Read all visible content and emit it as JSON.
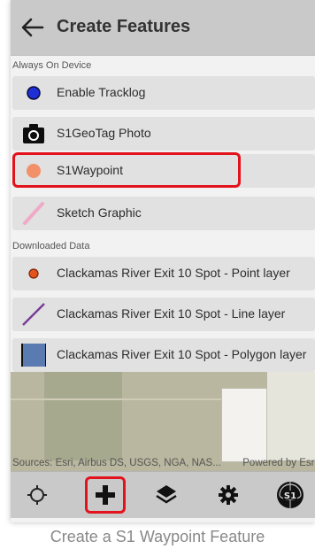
{
  "header": {
    "title": "Create Features"
  },
  "sections": {
    "device_label": "Always On Device",
    "downloaded_label": "Downloaded Data"
  },
  "device_items": [
    {
      "label": "Enable Tracklog",
      "icon": "blue-dot-icon"
    },
    {
      "label": "S1GeoTag Photo",
      "icon": "camera-icon"
    },
    {
      "label": "S1Waypoint",
      "icon": "orange-dot-icon"
    },
    {
      "label": "Sketch Graphic",
      "icon": "pink-line-icon"
    }
  ],
  "downloaded_items": [
    {
      "label": "Clackamas River Exit 10 Spot - Point layer",
      "icon": "point-layer-icon"
    },
    {
      "label": "Clackamas River Exit 10 Spot - Line layer",
      "icon": "line-layer-icon"
    },
    {
      "label": "Clackamas River Exit 10 Spot - Polygon layer",
      "icon": "polygon-layer-icon"
    }
  ],
  "map": {
    "attribution": "Sources: Esri, Airbus DS, USGS, NGA, NAS...",
    "powered_by": "Powered by Esri"
  },
  "toolbar": {
    "items": [
      "locate-icon",
      "add-icon",
      "layers-icon",
      "settings-icon",
      "s1-logo-icon"
    ]
  },
  "caption": "Create a S1 Waypoint Feature",
  "colors": {
    "header_bg": "#c9c9c9",
    "row_bg": "#e1e1e1",
    "highlight": "#e2131d",
    "tracklog_dot": "#1f2fd6",
    "waypoint_dot": "#f2906a",
    "sketch_line": "#f0a9c7",
    "point_layer": "#e3541f",
    "line_layer": "#7a3c9a",
    "polygon_layer": "#5a7bb1"
  }
}
